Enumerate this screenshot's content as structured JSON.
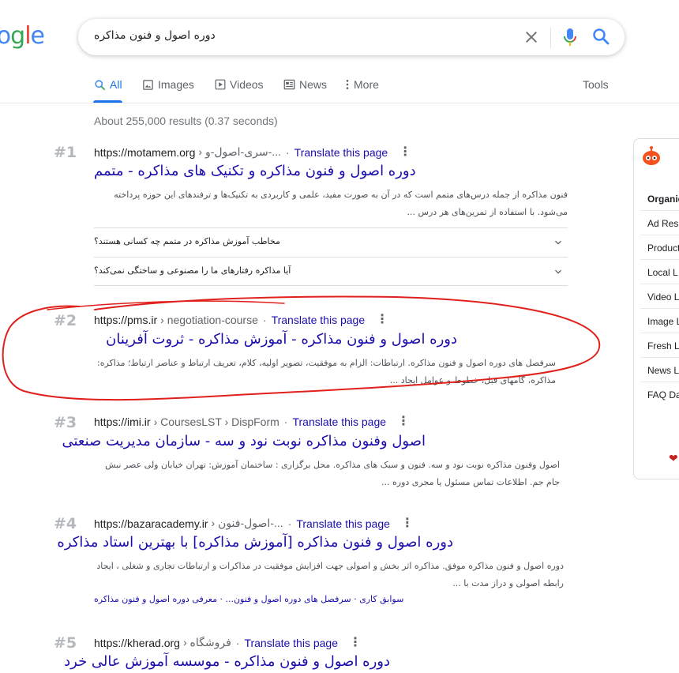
{
  "logo": {
    "text": "ogle"
  },
  "search": {
    "query": "دوره اصول و فنون مذاکره"
  },
  "tabs": [
    {
      "label": "All",
      "icon": "search-icon",
      "active": true
    },
    {
      "label": "Images",
      "icon": "image-icon",
      "active": false
    },
    {
      "label": "Videos",
      "icon": "video-icon",
      "active": false
    },
    {
      "label": "News",
      "icon": "news-icon",
      "active": false
    },
    {
      "label": "More",
      "icon": "more-vert-icon",
      "active": false
    }
  ],
  "tools_label": "Tools",
  "result_stats": "About 255,000 results (0.37 seconds)",
  "results": [
    {
      "rank": "#1",
      "site": "https://motamem.org",
      "path": "› سری-اصول-و-...",
      "translate": "Translate this page",
      "title": "دوره اصول و فنون مذاکره و تکنیک های مذاکره - متمم",
      "snippet": "فنون مذاکره از جمله درس‌های متمم است که در آن به صورت مفید، علمی و کاربردی به تکنیک‌ها و ترفندهای این حوزه پرداخته می‌شود. با استفاده از تمرین‌های هر درس ..."
    },
    {
      "rank": "#2",
      "site": "https://pms.ir",
      "path": "› negotiation-course",
      "translate": "Translate this page",
      "title": "دوره اصول و فنون مذاکره - آموزش مذاکره - ثروت آفرینان",
      "snippet": "سرفصل های دوره اصول و فنون مذاکره. ارتباطات: الزام به موفقیت، تصویر اولیه، کلام، تعریف ارتباط و عناصر ارتباط؛ مذاکره: مذاکره، گامهای قبل، خطوط و عوامل ایجاد ..."
    },
    {
      "rank": "#3",
      "site": "https://imi.ir",
      "path": "› CoursesLST › DispForm",
      "translate": "Translate this page",
      "title": "اصول وفنون مذاکره نوبت نود و سه - سازمان مدیریت صنعتی",
      "snippet": "اصول وفنون مذاکره نوبت نود و سه. فنون و سبک های مذاکره. محل برگزاری : ساختمان آموزش: تهران خیابان ولی عصر نبش جام جم. اطلاعات تماس مسئول یا مجری دوره ..."
    },
    {
      "rank": "#4",
      "site": "https://bazaracademy.ir",
      "path": "› اصول-فنون-...",
      "translate": "Translate this page",
      "title": "دوره اصول و فنون مذاکره [آموزش مذاکره] با بهترین استاد مذاکره",
      "snippet": "دوره اصول و فنون مذاکره موفق. مذاکره اثر بخش و اصولی جهت افزایش موفقیت در مذاکرات و ارتباطات تجاری و شغلی ، ایجاد رابطه اصولی و دراز مدت با ..."
    },
    {
      "rank": "#5",
      "site": "https://kherad.org",
      "path": "› فروشگاه",
      "translate": "Translate this page",
      "title": "دوره اصول و فنون مذاکره - موسسه آموزش عالی خرد",
      "snippet": ""
    }
  ],
  "faq": [
    "مخاطب آموزش مذاکره در متمم چه کسانی هستند؟",
    "آیا مذاکره رفتارهای ما را مصنوعی و ساختگی نمی‌کند؟"
  ],
  "sitelinks": "سوابق کاری · سرفصل های دوره اصول و فنون... · معرفی دوره اصول و فنون مذاکره",
  "right_panel": {
    "items": [
      "Organic",
      "Ad Res",
      "Product",
      "Local L",
      "Video L",
      "Image L",
      "Fresh L",
      "News L",
      "FAQ Da"
    ]
  },
  "colors": {
    "link": "#1a0dab",
    "accent": "#1a73e8",
    "annotation": "#e0201b"
  }
}
